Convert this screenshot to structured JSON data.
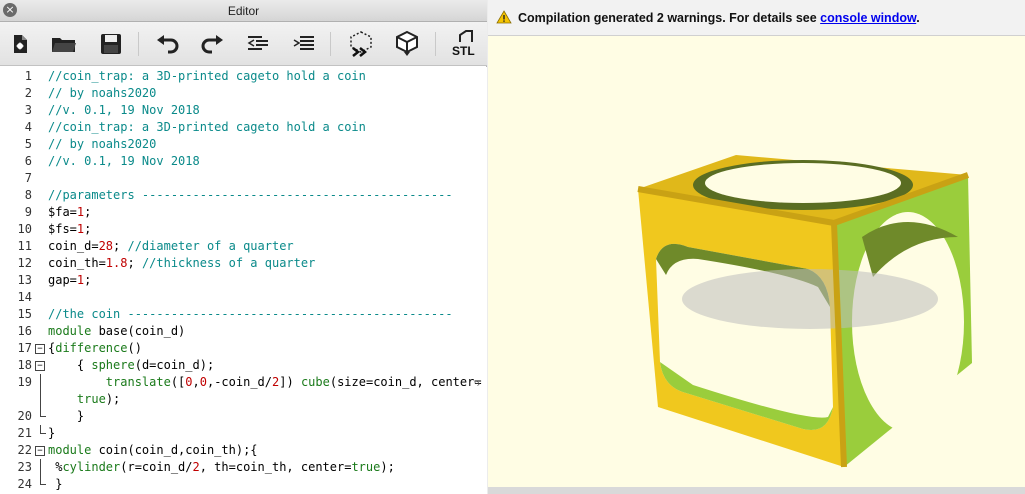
{
  "editor": {
    "title": "Editor",
    "toolbar": {
      "icons": [
        "new-file-icon",
        "open-folder-icon",
        "save-icon",
        "undo-icon",
        "redo-icon",
        "unindent-icon",
        "indent-icon",
        "preview-icon",
        "render-icon",
        "export-stl-icon"
      ],
      "stl_label": "STL"
    },
    "lines": [
      {
        "n": "1",
        "fold": "",
        "segs": [
          [
            "c",
            "//coin_trap: a 3D-printed cageto hold a coin"
          ]
        ]
      },
      {
        "n": "2",
        "fold": "",
        "segs": [
          [
            "c",
            "// by noahs2020"
          ]
        ]
      },
      {
        "n": "3",
        "fold": "",
        "segs": [
          [
            "c",
            "//v. 0.1, 19 Nov 2018"
          ]
        ]
      },
      {
        "n": "4",
        "fold": "",
        "segs": [
          [
            "c",
            "//coin_trap: a 3D-printed cageto hold a coin"
          ]
        ]
      },
      {
        "n": "5",
        "fold": "",
        "segs": [
          [
            "c",
            "// by noahs2020"
          ]
        ]
      },
      {
        "n": "6",
        "fold": "",
        "segs": [
          [
            "c",
            "//v. 0.1, 19 Nov 2018"
          ]
        ]
      },
      {
        "n": "7",
        "fold": "",
        "segs": []
      },
      {
        "n": "8",
        "fold": "",
        "segs": [
          [
            "c",
            "//parameters -------------------------------------------"
          ]
        ]
      },
      {
        "n": "9",
        "fold": "",
        "segs": [
          [
            "p",
            "$fa="
          ],
          [
            "n",
            "1"
          ],
          [
            "p",
            ";"
          ]
        ]
      },
      {
        "n": "10",
        "fold": "",
        "segs": [
          [
            "p",
            "$fs="
          ],
          [
            "n",
            "1"
          ],
          [
            "p",
            ";"
          ]
        ]
      },
      {
        "n": "11",
        "fold": "",
        "segs": [
          [
            "p",
            "coin_d="
          ],
          [
            "n",
            "28"
          ],
          [
            "p",
            "; "
          ],
          [
            "c",
            "//diameter of a quarter"
          ]
        ]
      },
      {
        "n": "12",
        "fold": "",
        "segs": [
          [
            "p",
            "coin_th="
          ],
          [
            "n",
            "1.8"
          ],
          [
            "p",
            "; "
          ],
          [
            "c",
            "//thickness of a quarter"
          ]
        ]
      },
      {
        "n": "13",
        "fold": "",
        "segs": [
          [
            "p",
            "gap="
          ],
          [
            "n",
            "1"
          ],
          [
            "p",
            ";"
          ]
        ]
      },
      {
        "n": "14",
        "fold": "",
        "segs": []
      },
      {
        "n": "15",
        "fold": "",
        "segs": [
          [
            "c",
            "//the coin ---------------------------------------------"
          ]
        ]
      },
      {
        "n": "16",
        "fold": "",
        "segs": [
          [
            "k",
            "module"
          ],
          [
            "p",
            " base(coin_d)"
          ]
        ]
      },
      {
        "n": "17",
        "fold": "box",
        "segs": [
          [
            "p",
            "{"
          ],
          [
            "k",
            "difference"
          ],
          [
            "p",
            "()"
          ]
        ]
      },
      {
        "n": "18",
        "fold": "box",
        "segs": [
          [
            "p",
            "    { "
          ],
          [
            "k",
            "sphere"
          ],
          [
            "p",
            "(d=coin_d);"
          ]
        ]
      },
      {
        "n": "",
        "fold": "vline",
        "segs": [
          [
            "p",
            "        "
          ],
          [
            "k",
            "translate"
          ],
          [
            "p",
            "(["
          ],
          [
            "n",
            "0"
          ],
          [
            "p",
            ","
          ],
          [
            "n",
            "0"
          ],
          [
            "p",
            ",-coin_d/"
          ],
          [
            "n",
            "2"
          ],
          [
            "p",
            "]) "
          ],
          [
            "k",
            "cube"
          ],
          [
            "p",
            "(size=coin_d, center="
          ]
        ],
        "wrap": "⤷"
      },
      {
        "n": "",
        "fold": "vline",
        "segs": [
          [
            "p",
            "    "
          ],
          [
            "k",
            "true"
          ],
          [
            "p",
            ");"
          ]
        ]
      },
      {
        "n": "20",
        "fold": "end",
        "segs": [
          [
            "p",
            "    }"
          ]
        ]
      },
      {
        "n": "21",
        "fold": "end",
        "segs": [
          [
            "p",
            "}"
          ]
        ]
      },
      {
        "n": "22",
        "fold": "box",
        "segs": [
          [
            "k",
            "module"
          ],
          [
            "p",
            " coin(coin_d,coin_th);{"
          ]
        ]
      },
      {
        "n": "23",
        "fold": "vline",
        "segs": [
          [
            "p",
            " %"
          ],
          [
            "k",
            "cylinder"
          ],
          [
            "p",
            "(r=coin_d/"
          ],
          [
            "n",
            "2"
          ],
          [
            "p",
            ", th=coin_th, center="
          ],
          [
            "k",
            "true"
          ],
          [
            "p",
            ");"
          ]
        ]
      },
      {
        "n": "24",
        "fold": "end",
        "segs": [
          [
            "p",
            " }"
          ]
        ]
      }
    ],
    "line19_number": "19"
  },
  "viewer": {
    "warning_text": "Compilation generated 2 warnings. For details see ",
    "warning_link": "console window",
    "warning_tail": ".",
    "colors": {
      "background": "#fffde4",
      "cage_yellow": "#f0c81e",
      "cage_green": "#9acd3c",
      "coin_gray": "#b4b4b4"
    }
  }
}
